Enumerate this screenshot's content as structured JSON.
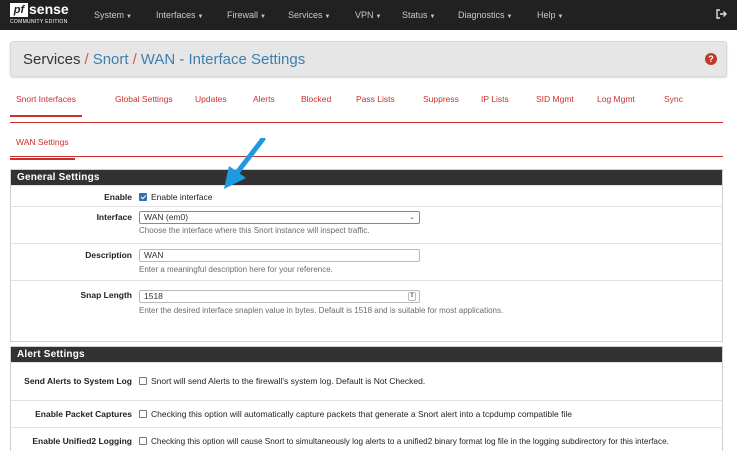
{
  "navbar": {
    "logo_brand": "sense",
    "logo_pf": "pf",
    "logo_edition": "COMMUNITY EDITION",
    "menus": [
      "System",
      "Interfaces",
      "Firewall",
      "Services",
      "VPN",
      "Status",
      "Diagnostics",
      "Help"
    ]
  },
  "breadcrumb": {
    "root": "Services",
    "section": "Snort",
    "page": "WAN - Interface Settings"
  },
  "tabs": [
    "Snort Interfaces",
    "Global Settings",
    "Updates",
    "Alerts",
    "Blocked",
    "Pass Lists",
    "Suppress",
    "IP Lists",
    "SID Mgmt",
    "Log Mgmt",
    "Sync"
  ],
  "subtabs": [
    "WAN Settings"
  ],
  "general": {
    "title": "General Settings",
    "enable_label": "Enable",
    "enable_text": "Enable interface",
    "enable_checked": true,
    "interface_label": "Interface",
    "interface_value": "WAN (em0)",
    "interface_help": "Choose the interface where this Snort instance will inspect traffic.",
    "description_label": "Description",
    "description_value": "WAN",
    "description_help": "Enter a meaningful description here for your reference.",
    "snaplen_label": "Snap Length",
    "snaplen_value": "1518",
    "snaplen_help": "Enter the desired interface snaplen value in bytes. Default is 1518 and is suitable for most applications."
  },
  "alert": {
    "title": "Alert Settings",
    "syslog_label": "Send Alerts to System Log",
    "syslog_text": "Snort will send Alerts to the firewall's system log. Default is Not Checked.",
    "packet_label": "Enable Packet Captures",
    "packet_text": "Checking this option will automatically capture packets that generate a Snort alert into a tcpdump compatible file",
    "unified2_label": "Enable Unified2 Logging",
    "unified2_text": "Checking this option will cause Snort to simultaneously log alerts to a unified2 binary format log file in the logging subdirectory for this interface."
  },
  "colors": {
    "navbar": "#212121",
    "accent_red": "#c9302c",
    "link_blue": "#3c7fb1",
    "panel_head": "#323232",
    "annotation_arrow": "#1e9be0"
  }
}
